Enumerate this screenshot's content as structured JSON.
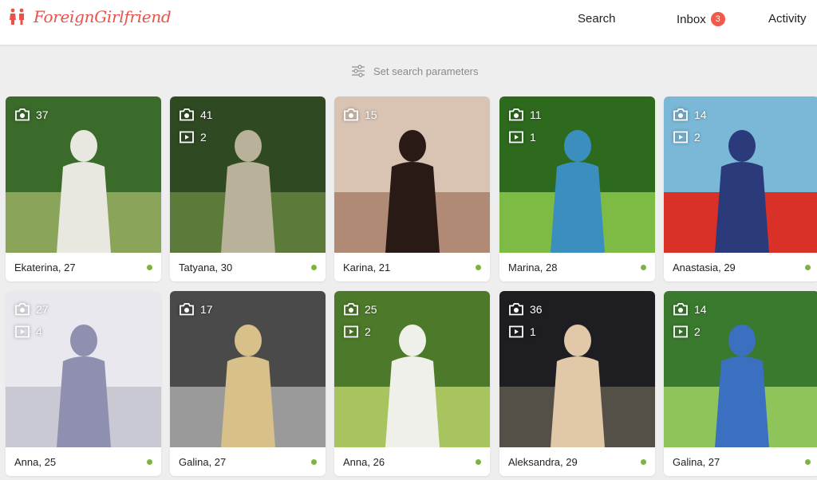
{
  "header": {
    "logo_text": "ForeignGirlfriend",
    "nav": {
      "search": "Search",
      "inbox": "Inbox",
      "inbox_count": "3",
      "activity": "Activity"
    },
    "accent_color": "#e8524b"
  },
  "filters": {
    "label": "Set search parameters"
  },
  "profiles": [
    {
      "caption": "Ekaterina, 27",
      "photos": "37",
      "videos": "",
      "online": true,
      "colors": [
        "#3a6b2a",
        "#8aa55a",
        "#e8e8e0"
      ]
    },
    {
      "caption": "Tatyana, 30",
      "photos": "41",
      "videos": "2",
      "online": true,
      "colors": [
        "#2f4a22",
        "#5c7a3a",
        "#b9b29a"
      ]
    },
    {
      "caption": "Karina, 21",
      "photos": "15",
      "videos": "",
      "online": true,
      "colors": [
        "#d9c4b4",
        "#b08a74",
        "#2a1a16"
      ]
    },
    {
      "caption": "Marina, 28",
      "photos": "11",
      "videos": "1",
      "online": true,
      "colors": [
        "#2e6a1e",
        "#7dbb44",
        "#3b8fbf"
      ]
    },
    {
      "caption": "Anastasia, 29",
      "photos": "14",
      "videos": "2",
      "online": true,
      "colors": [
        "#7bb8d8",
        "#d93028",
        "#2a3a7a"
      ]
    },
    {
      "caption": "Anna, 25",
      "photos": "27",
      "videos": "4",
      "online": true,
      "colors": [
        "#e8e8ee",
        "#c9c9d4",
        "#8f8fb0"
      ]
    },
    {
      "caption": "Galina, 27",
      "photos": "17",
      "videos": "",
      "online": true,
      "colors": [
        "#4a4a4a",
        "#9a9a9a",
        "#d8c08a"
      ]
    },
    {
      "caption": "Anna, 26",
      "photos": "25",
      "videos": "2",
      "online": true,
      "colors": [
        "#4d7a2a",
        "#a8c45e",
        "#f0f0ea"
      ]
    },
    {
      "caption": "Aleksandra, 29",
      "photos": "36",
      "videos": "1",
      "online": true,
      "colors": [
        "#1e1e22",
        "#545048",
        "#e0c8a8"
      ]
    },
    {
      "caption": "Galina, 27",
      "photos": "14",
      "videos": "2",
      "online": true,
      "colors": [
        "#3a7a2e",
        "#8ec45a",
        "#3b6fc0"
      ]
    }
  ]
}
